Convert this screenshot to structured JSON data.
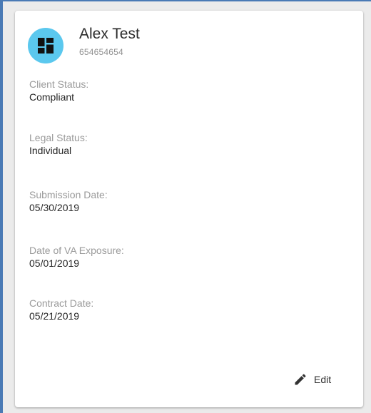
{
  "colors": {
    "avatar_bg": "#5bc8ee",
    "frame_accent": "#4a7ab5",
    "label_text": "#9a9a9a",
    "value_text": "#262626"
  },
  "client": {
    "avatar_icon": "dashboard-icon",
    "name": "Alex Test",
    "account_number": "654654654"
  },
  "fields": [
    {
      "label": "Client Status:",
      "value": "Compliant"
    },
    {
      "label": "Legal Status:",
      "value": "Individual"
    },
    {
      "label": "Submission Date:",
      "value": "05/30/2019"
    },
    {
      "label": "Date of VA Exposure:",
      "value": "05/01/2019"
    },
    {
      "label": "Contract Date:",
      "value": "05/21/2019"
    }
  ],
  "actions": {
    "edit_icon": "pencil-icon",
    "edit_label": "Edit"
  }
}
